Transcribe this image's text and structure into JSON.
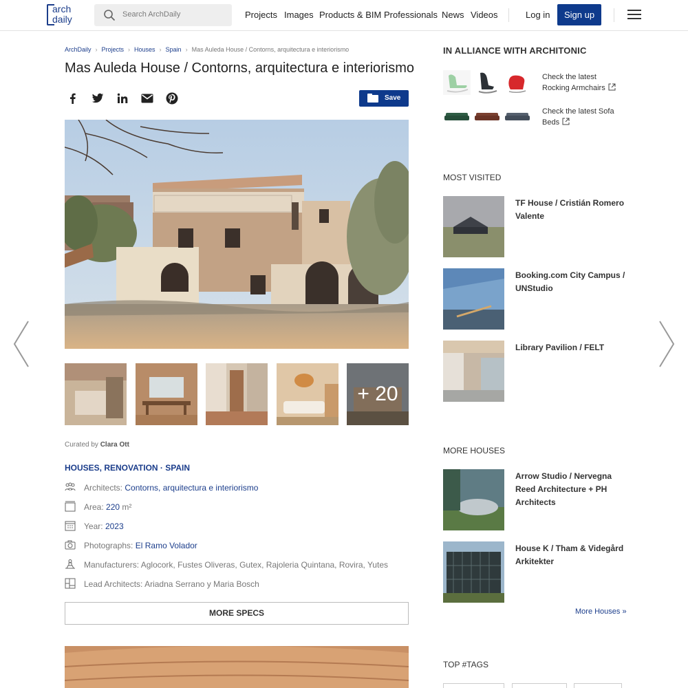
{
  "header": {
    "logo_text_line1": "arch",
    "logo_text_line2": "daily",
    "search_placeholder": "Search ArchDaily",
    "nav": [
      "Projects",
      "Images",
      "Products & BIM",
      "Professionals",
      "News",
      "Videos"
    ],
    "login_label": "Log in",
    "signup_label": "Sign up"
  },
  "breadcrumb": [
    "ArchDaily",
    "Projects",
    "Houses",
    "Spain",
    "Mas Auleda House / Contorns, arquitectura e interiorismo"
  ],
  "title": "Mas Auleda House / Contorns, arquitectura e interiorismo",
  "share": {
    "save_label": "Save"
  },
  "gallery": {
    "more_count": "+ 20"
  },
  "curated": {
    "prefix": "Curated by",
    "name": "Clara Ott"
  },
  "categories": "HOUSES, RENOVATION · SPAIN",
  "specs": {
    "architects_k": "Architects:",
    "architects_v": "Contorns, arquitectura e interiorismo",
    "area_k": "Area:",
    "area_v": "220",
    "area_unit": "m²",
    "year_k": "Year:",
    "year_v": "2023",
    "photographs_k": "Photographs:",
    "photographs_v": "El Ramo Volador",
    "manufacturers_k": "Manufacturers:",
    "manufacturers_v": "Aglocork, Fustes Oliveras, Gutex, Rajoleria Quintana, Rovira, Yutes",
    "lead_k": "Lead Architects:",
    "lead_v": "Ariadna Serrano y Maria Bosch"
  },
  "more_specs_label": "MORE SPECS",
  "sidebar": {
    "alliance_title": "IN ALLIANCE WITH ARCHITONIC",
    "check1_line1": "Check the latest",
    "check1_line2": "Rocking Armchairs",
    "check2_line1": "Check the latest Sofa",
    "check2_line2": "Beds",
    "most_visited_title": "MOST VISITED",
    "most_visited": [
      {
        "title": "TF House / Cristián Romero Valente"
      },
      {
        "title": "Booking.com City Campus / UNStudio"
      },
      {
        "title": "Library Pavilion / FELT"
      }
    ],
    "more_houses_title": "MORE HOUSES",
    "more_houses": [
      {
        "title": "Arrow Studio / Nervegna Reed Architecture + PH Architects"
      },
      {
        "title": "House K / Tham & Videgård Arkitekter"
      }
    ],
    "more_houses_link": "More Houses »",
    "top_tags_title": "TOP #TAGS"
  }
}
